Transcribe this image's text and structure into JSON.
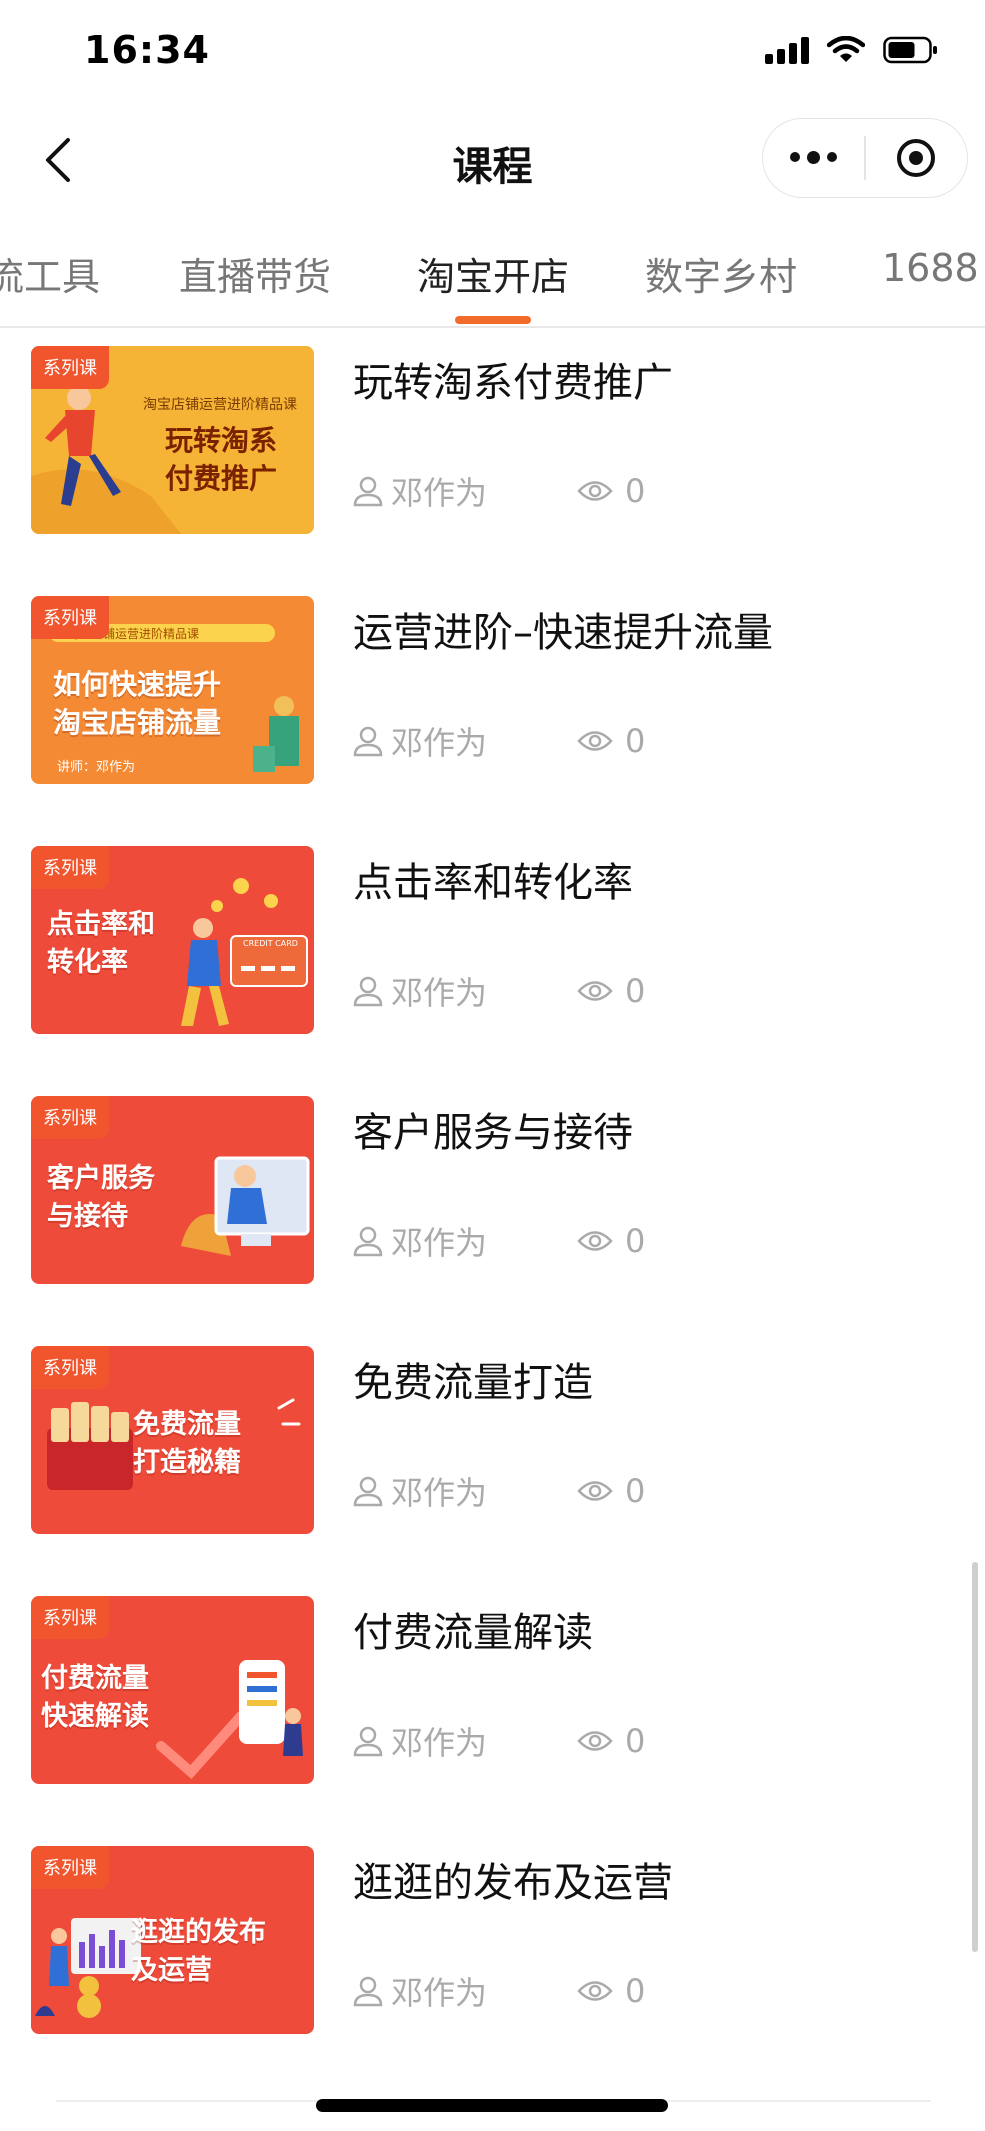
{
  "status_bar": {
    "time": "16:34"
  },
  "nav": {
    "title": "课程"
  },
  "tabs": [
    {
      "label": "流工具",
      "active": false
    },
    {
      "label": "直播带货",
      "active": false
    },
    {
      "label": "淘宝开店",
      "active": true
    },
    {
      "label": "数字乡村",
      "active": false
    },
    {
      "label": "1688",
      "active": false
    }
  ],
  "colors": {
    "accent": "#f26b2a",
    "badge": "#f0552e",
    "meta": "#aaaaaa"
  },
  "courses": [
    {
      "badge": "系列课",
      "title": "玩转淘系付费推广",
      "author": "邓作为",
      "views": "0",
      "thumb": {
        "heading": "玩转淘系\n付费推广",
        "subheading": "淘宝店铺运营进阶精品课"
      }
    },
    {
      "badge": "系列课",
      "title": "运营进阶–快速提升流量",
      "author": "邓作为",
      "views": "0",
      "thumb": {
        "heading": "如何快速提升\n淘宝店铺流量",
        "subheading": "淘宝店铺运营进阶精品课",
        "caption": "讲师：邓作为"
      }
    },
    {
      "badge": "系列课",
      "title": "点击率和转化率",
      "author": "邓作为",
      "views": "0",
      "thumb": {
        "heading": "点击率和\n转化率",
        "card_text": "CREDIT CARD"
      }
    },
    {
      "badge": "系列课",
      "title": "客户服务与接待",
      "author": "邓作为",
      "views": "0",
      "thumb": {
        "heading": "客户服务\n与接待"
      }
    },
    {
      "badge": "系列课",
      "title": "免费流量打造",
      "author": "邓作为",
      "views": "0",
      "thumb": {
        "heading": "免费流量\n打造秘籍"
      }
    },
    {
      "badge": "系列课",
      "title": "付费流量解读",
      "author": "邓作为",
      "views": "0",
      "thumb": {
        "heading": "付费流量\n快速解读"
      }
    },
    {
      "badge": "系列课",
      "title": "逛逛的发布及运营",
      "author": "邓作为",
      "views": "0",
      "thumb": {
        "heading": "逛逛的发布\n及运营"
      }
    }
  ]
}
